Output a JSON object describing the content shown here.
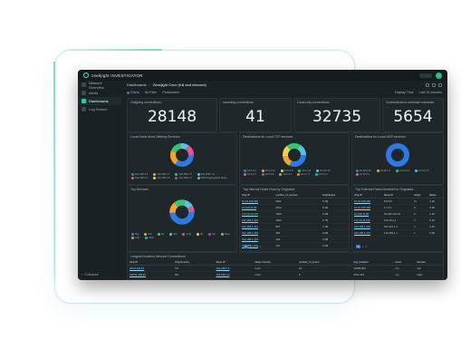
{
  "brand": {
    "name": "zeek|ight INVESTIGATOR"
  },
  "sidebar": {
    "items": [
      {
        "label": "Network Overview"
      },
      {
        "label": "Alerts"
      },
      {
        "label": "Dashboards"
      },
      {
        "label": "Log Search"
      }
    ],
    "collapse_label": "Collapse"
  },
  "breadcrumb": {
    "root": "Dashboards",
    "current": "Zeek|ight Conn (full and inbound)"
  },
  "filters": {
    "items": [
      "Filters",
      "No Filter",
      "Parameters"
    ],
    "right": [
      "Display Time",
      "Last 15 minutes"
    ]
  },
  "kpis": [
    {
      "title": "Outgoing connections",
      "value": "28148"
    },
    {
      "title": "Incoming connections",
      "value": "41"
    },
    {
      "title": "Local-only connections",
      "value": "32735"
    },
    {
      "title": "Connections to unknown networks",
      "value": "5654"
    }
  ],
  "donut_panels": [
    {
      "title": "Local Hosts Most Offering Services",
      "legend": [
        "192.168.1.6",
        "192.168.1.3",
        "192.168.1.5",
        "192.168.1.11",
        "192.168.1.4",
        "192.168.1.8",
        "192.168.1.2",
        "Other/Aggregated Hosts"
      ]
    },
    {
      "title": "Destinations for Local TCP services",
      "legend": [
        "10.0.0.1",
        "10.0.1.11",
        "10.0.2.5",
        "10.1.1.8",
        "10.0.0.12",
        "10.0.4.4",
        "10.0.0.8",
        "10.1.2.6",
        "10.2.1.7",
        "10.3.3.3"
      ]
    },
    {
      "title": "Destinations for Local UDP services",
      "legend": [
        "10.10.0.53",
        "10.10.1.1",
        "10.10.2.2",
        "10.10.3.3",
        "10.10.4.4"
      ]
    },
    {
      "title": "Top Services",
      "legend": [
        "http",
        "dns",
        "ssl",
        "ssh",
        "smtp",
        "ftp",
        "ntp",
        "dhcp",
        "smb",
        "other"
      ]
    }
  ],
  "tables": [
    {
      "title": "Top Internal Hosts Flow by Originator",
      "headers": [
        "Orig IP",
        "number_of_connec...",
        "Originbytes"
      ],
      "rows": [
        [
          "10.10.100.199",
          "2621",
          "5.1M"
        ],
        [
          "10.100.11.99",
          "2512",
          "9.1M"
        ],
        [
          "172.16.11.100",
          "1843",
          "4.3M"
        ],
        [
          "192.168.1.100",
          "1450",
          "2.7M"
        ],
        [
          "192.168.1.101",
          "897",
          "1.1M"
        ],
        [
          "192.168.1.102",
          "456",
          "0.9M"
        ],
        [
          "192.168.1.103",
          "229",
          "0.4M"
        ],
        [
          "192.168.1.104",
          "101",
          "0.2M"
        ]
      ]
    },
    {
      "title": "Top External Flows Destined to Originator",
      "headers": [
        "Orig IP",
        "Resp IP",
        "Origin",
        "Bytes"
      ],
      "rows": [
        [
          "10.10.100.199",
          "8.8.8.8",
          "11",
          "0.3K"
        ],
        [
          "10.10.100.199",
          "1.1.1.1",
          "8",
          "0.2K"
        ],
        [
          "10.100.11.99",
          "93.184.216.34",
          "6",
          "0.1K"
        ],
        [
          "172.16.11.100",
          "104.16.1.1",
          "3",
          "0.1K"
        ],
        [
          "192.168.1.100",
          "151.101.1.1",
          "2",
          "0.1K"
        ],
        [
          "192.168.1.101",
          "142.250.1.1",
          "1",
          "0.0K"
        ]
      ]
    },
    {
      "title": "Longest Duration Inbound Connections",
      "headers": [
        "Orig IP",
        "Orig Country",
        "Resp IP",
        "Resp Country",
        "number_of_conns",
        "avg_duration",
        "proto",
        "Service"
      ],
      "rows": [
        [
          "203.0.113.10",
          "US",
          "192.168.1.5",
          "local",
          "16",
          "15486.003",
          "tcp",
          "ssh"
        ],
        [
          "198.51.100.20",
          "DE",
          "192.168.1.6",
          "local",
          "9",
          "9211.443",
          "tcp",
          "https"
        ]
      ]
    }
  ],
  "colors": {
    "accent": "#27c08a",
    "blue": "#2c7be5",
    "orange": "#f3a533",
    "yellow": "#e8d44d",
    "green": "#37c472",
    "teal": "#5bc0de",
    "pink": "#e05b8b"
  }
}
